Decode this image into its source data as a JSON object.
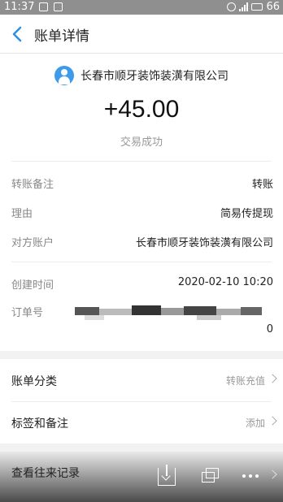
{
  "status_bar": {
    "time": "11:37",
    "battery": "66"
  },
  "header": {
    "title": "账单详情"
  },
  "transaction": {
    "payee": "长春市顺牙装饰装潢有限公司",
    "amount": "+45.00",
    "status": "交易成功"
  },
  "details": [
    {
      "key": "转账备注",
      "value": "转账"
    },
    {
      "key": "理由",
      "value": "简易传提现"
    },
    {
      "key": "对方账户",
      "value": "长春市顺牙装饰装潢有限公司"
    },
    {
      "key": "创建时间",
      "value": "2020-02-10 10:20"
    },
    {
      "key": "订单号",
      "value": "0"
    }
  ],
  "actions": [
    {
      "label": "账单分类",
      "value": "转账充值"
    },
    {
      "label": "标签和备注",
      "value": "添加"
    }
  ],
  "bottom": {
    "label": "查看往来记录"
  },
  "colors": {
    "accent": "#3e9bea",
    "status_bar": "#8f8f8f"
  }
}
